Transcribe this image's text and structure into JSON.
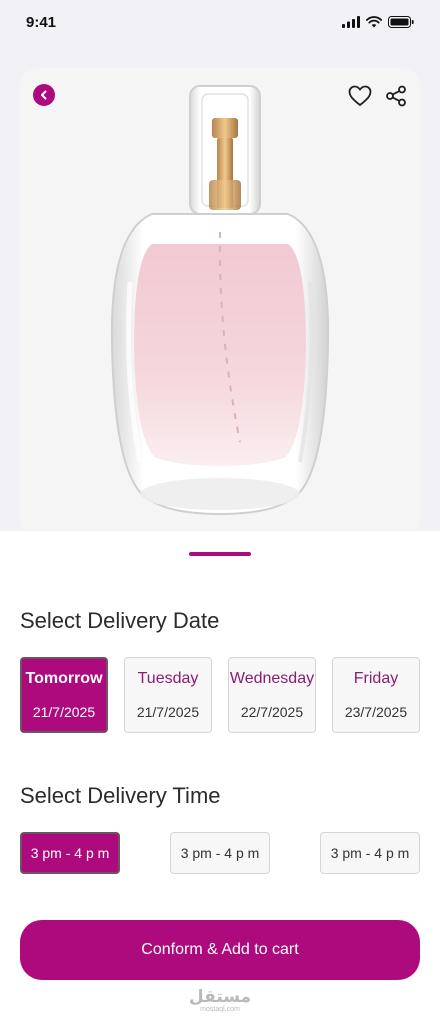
{
  "status_bar": {
    "time": "9:41"
  },
  "icons": {
    "back": "chevron-left-icon",
    "favorite": "heart-icon",
    "share": "share-icon",
    "signal": "signal-icon",
    "wifi": "wifi-icon",
    "battery": "battery-icon"
  },
  "colors": {
    "accent": "#ad0b7d",
    "selected_border": "#6a5560"
  },
  "delivery_date": {
    "title": "Select Delivery Date",
    "options": [
      {
        "day": "Tomorrow",
        "date": "21/7/2025",
        "selected": true
      },
      {
        "day": "Tuesday",
        "date": "21/7/2025",
        "selected": false
      },
      {
        "day": "Wednesday",
        "date": "22/7/2025",
        "selected": false
      },
      {
        "day": "Friday",
        "date": "23/7/2025",
        "selected": false
      }
    ]
  },
  "delivery_time": {
    "title": "Select Delivery Time",
    "options": [
      {
        "label": "3 pm - 4 p m",
        "selected": true
      },
      {
        "label": "3 pm - 4 p m",
        "selected": false
      },
      {
        "label": "3 pm - 4 p m",
        "selected": false
      }
    ]
  },
  "cta": {
    "label": "Conform & Add to cart"
  },
  "watermark": {
    "text": "مستقل",
    "subtext": "mostaql.com"
  }
}
